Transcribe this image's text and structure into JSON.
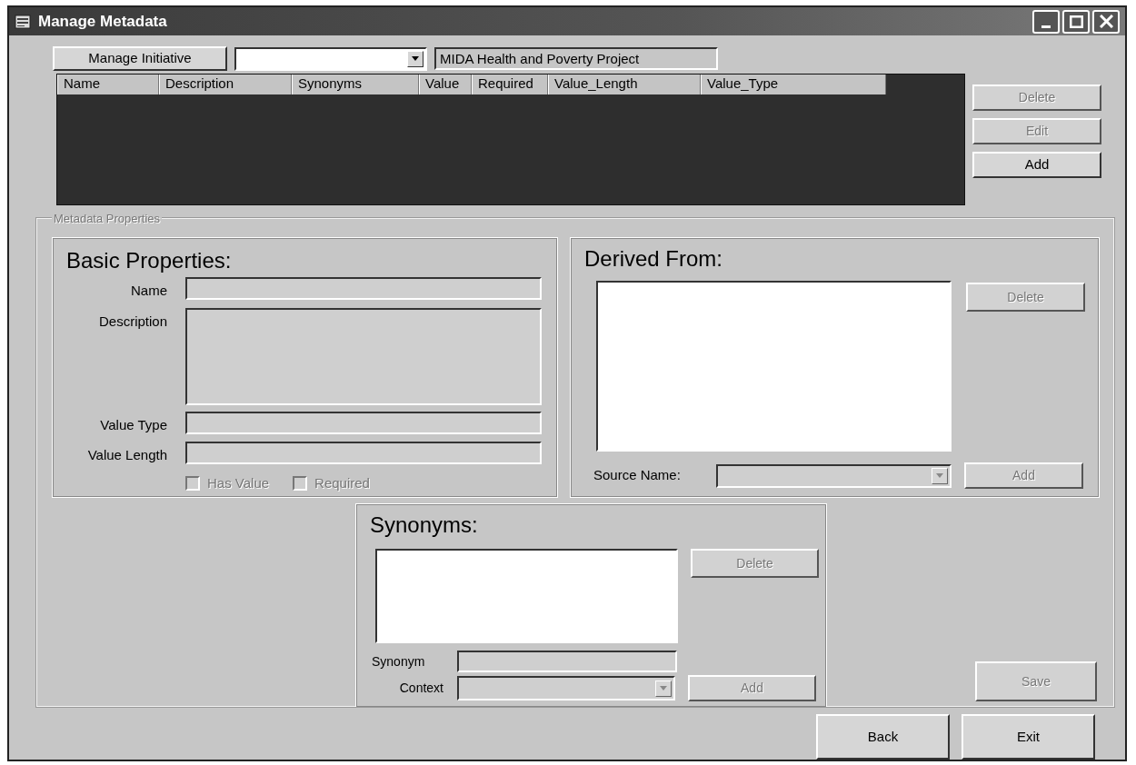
{
  "window": {
    "title": "Manage Metadata"
  },
  "manage_initiative_button": {
    "label": "Manage Initiative"
  },
  "project_label": "MIDA Health and Poverty Project",
  "table": {
    "columns": [
      "Name",
      "Description",
      "Synonyms",
      "Value",
      "Required",
      "Value_Length",
      "Value_Type"
    ]
  },
  "table_buttons": [
    {
      "label": "Delete",
      "disabled": true
    },
    {
      "label": "Edit",
      "disabled": true
    },
    {
      "label": "Add",
      "disabled": false
    }
  ],
  "group_title": "Metadata Properties",
  "basic_properties": {
    "title": "Basic Properties:",
    "fields": [
      {
        "label": "Name",
        "kind": "text",
        "disabled": true
      },
      {
        "label": "Description",
        "kind": "textarea",
        "disabled": true
      },
      {
        "label": "Value Type",
        "kind": "text",
        "disabled": true
      },
      {
        "label": "Value Length",
        "kind": "text",
        "disabled": true
      }
    ],
    "checkboxes": [
      {
        "label": "Has Value",
        "checked": false,
        "disabled": true
      },
      {
        "label": "Required",
        "checked": false,
        "disabled": true
      }
    ]
  },
  "derived_from": {
    "title": "Derived From:",
    "delete_button": {
      "label": "Delete",
      "disabled": true
    },
    "source_label": "Source Name:",
    "add_button": {
      "label": "Add",
      "disabled": true
    }
  },
  "synonyms": {
    "title": "Synonyms:",
    "delete_button": {
      "label": "Delete",
      "disabled": true
    },
    "synonym_label": "Synonym",
    "context_label": "Context",
    "add_button": {
      "label": "Add",
      "disabled": true
    }
  },
  "save_button": {
    "label": "Save",
    "disabled": true
  },
  "footer_buttons": [
    {
      "label": "Back",
      "disabled": false
    },
    {
      "label": "Exit",
      "disabled": false
    }
  ]
}
